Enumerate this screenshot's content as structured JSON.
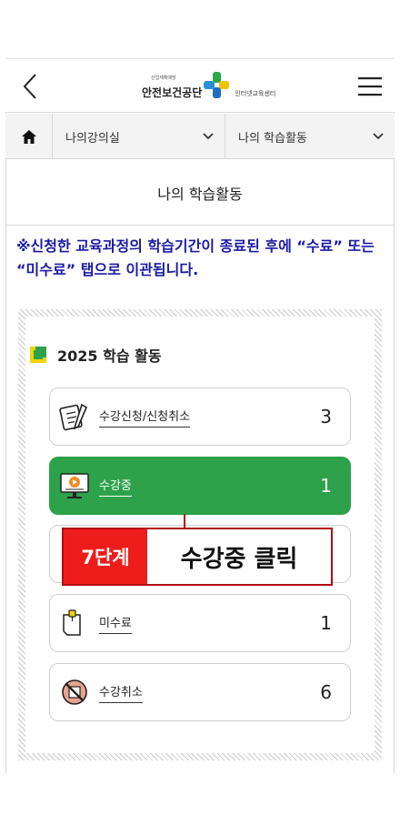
{
  "header": {
    "logo_small": "산업재해예방",
    "logo_main": "안전보건공단",
    "logo_sub": "인터넷교육센터"
  },
  "nav": {
    "select_one": "나의강의실",
    "select_two": "나의 학습활동"
  },
  "page_title": "나의 학습활동",
  "notice": "※신청한 교육과정의 학습기간이 종료된 후에 “수료” 또는 “미수료” 탭으로 이관됩니다.",
  "section": {
    "title": "2025 학습 활동",
    "items": [
      {
        "label": "수강신청/신청취소",
        "count": "3",
        "icon": "clipboard-pen-icon"
      },
      {
        "label": "수강중",
        "count": "1",
        "icon": "monitor-play-icon"
      },
      {
        "label": "",
        "count": "",
        "icon": "document-icon"
      },
      {
        "label": "미수료",
        "count": "1",
        "icon": "clipboard-pin-icon"
      },
      {
        "label": "수강취소",
        "count": "6",
        "icon": "cancel-icon"
      }
    ]
  },
  "callout": {
    "step": "7단계",
    "text": "수강중 클릭"
  },
  "colors": {
    "accent_green": "#2da24a",
    "notice_blue": "#1a1aa6",
    "callout_red": "#ef1c1c"
  }
}
